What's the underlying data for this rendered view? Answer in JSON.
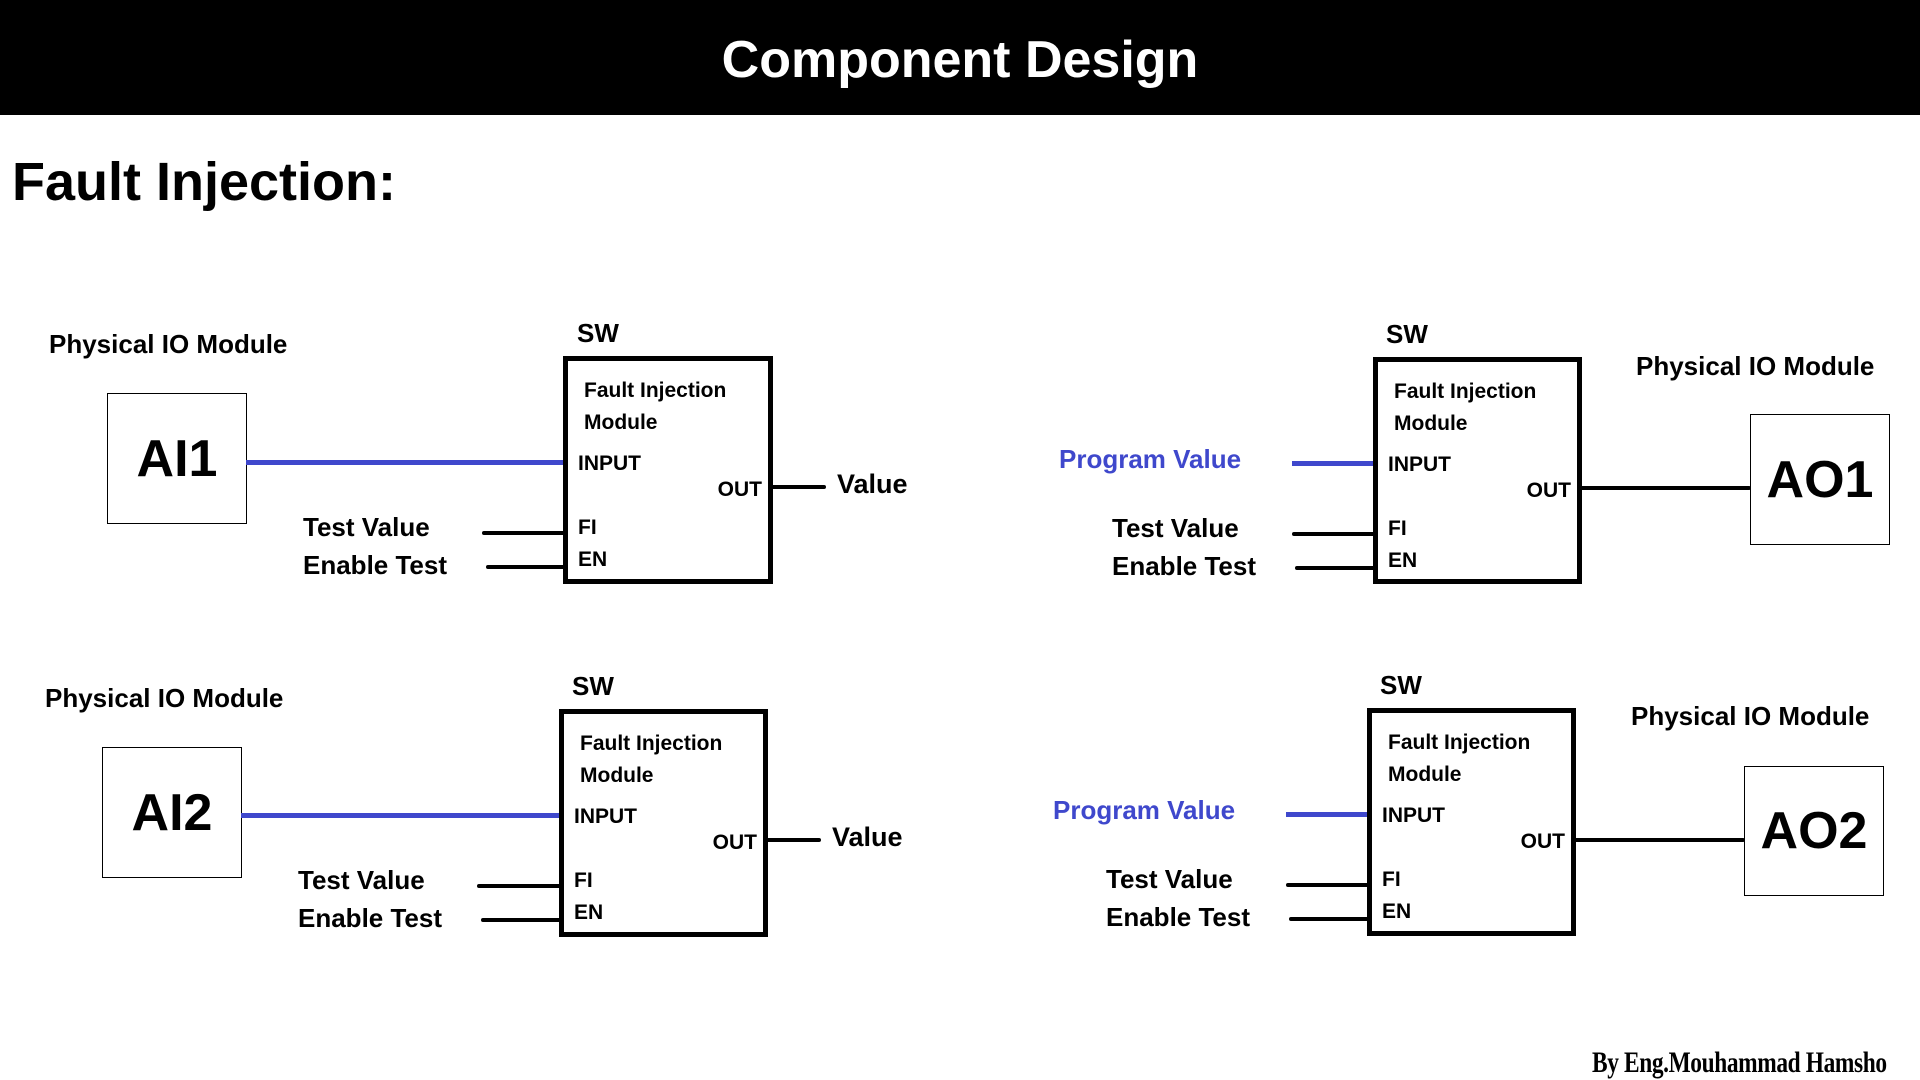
{
  "header": {
    "title": "Component Design"
  },
  "section": {
    "title": "Fault Injection:"
  },
  "blocks": [
    {
      "io_label": "Physical IO Module",
      "io_name": "AI1",
      "sw_label": "SW",
      "module_title_line1": "Fault Injection",
      "module_title_line2": "Module",
      "port_input": "INPUT",
      "port_out": "OUT",
      "port_fi": "FI",
      "port_en": "EN",
      "input_signal": "",
      "output_signal": "Value",
      "fi_signal": "Test Value",
      "en_signal": "Enable Test"
    },
    {
      "io_label": "Physical IO Module",
      "io_name": "AO1",
      "sw_label": "SW",
      "module_title_line1": "Fault Injection",
      "module_title_line2": "Module",
      "port_input": "INPUT",
      "port_out": "OUT",
      "port_fi": "FI",
      "port_en": "EN",
      "input_signal": "Program Value",
      "output_signal": "",
      "fi_signal": "Test Value",
      "en_signal": "Enable Test"
    },
    {
      "io_label": "Physical IO Module",
      "io_name": "AI2",
      "sw_label": "SW",
      "module_title_line1": "Fault Injection",
      "module_title_line2": "Module",
      "port_input": "INPUT",
      "port_out": "OUT",
      "port_fi": "FI",
      "port_en": "EN",
      "input_signal": "",
      "output_signal": "Value",
      "fi_signal": "Test Value",
      "en_signal": "Enable Test"
    },
    {
      "io_label": "Physical IO Module",
      "io_name": "AO2",
      "sw_label": "SW",
      "module_title_line1": "Fault Injection",
      "module_title_line2": "Module",
      "port_input": "INPUT",
      "port_out": "OUT",
      "port_fi": "FI",
      "port_en": "EN",
      "input_signal": "Program Value",
      "output_signal": "",
      "fi_signal": "Test Value",
      "en_signal": "Enable Test"
    }
  ],
  "colors": {
    "signal_blue": "#3f48cc",
    "header_bg": "#000000",
    "header_text": "#ffffff"
  },
  "footer": {
    "credit": "By Eng.Mouhammad Hamsho"
  }
}
